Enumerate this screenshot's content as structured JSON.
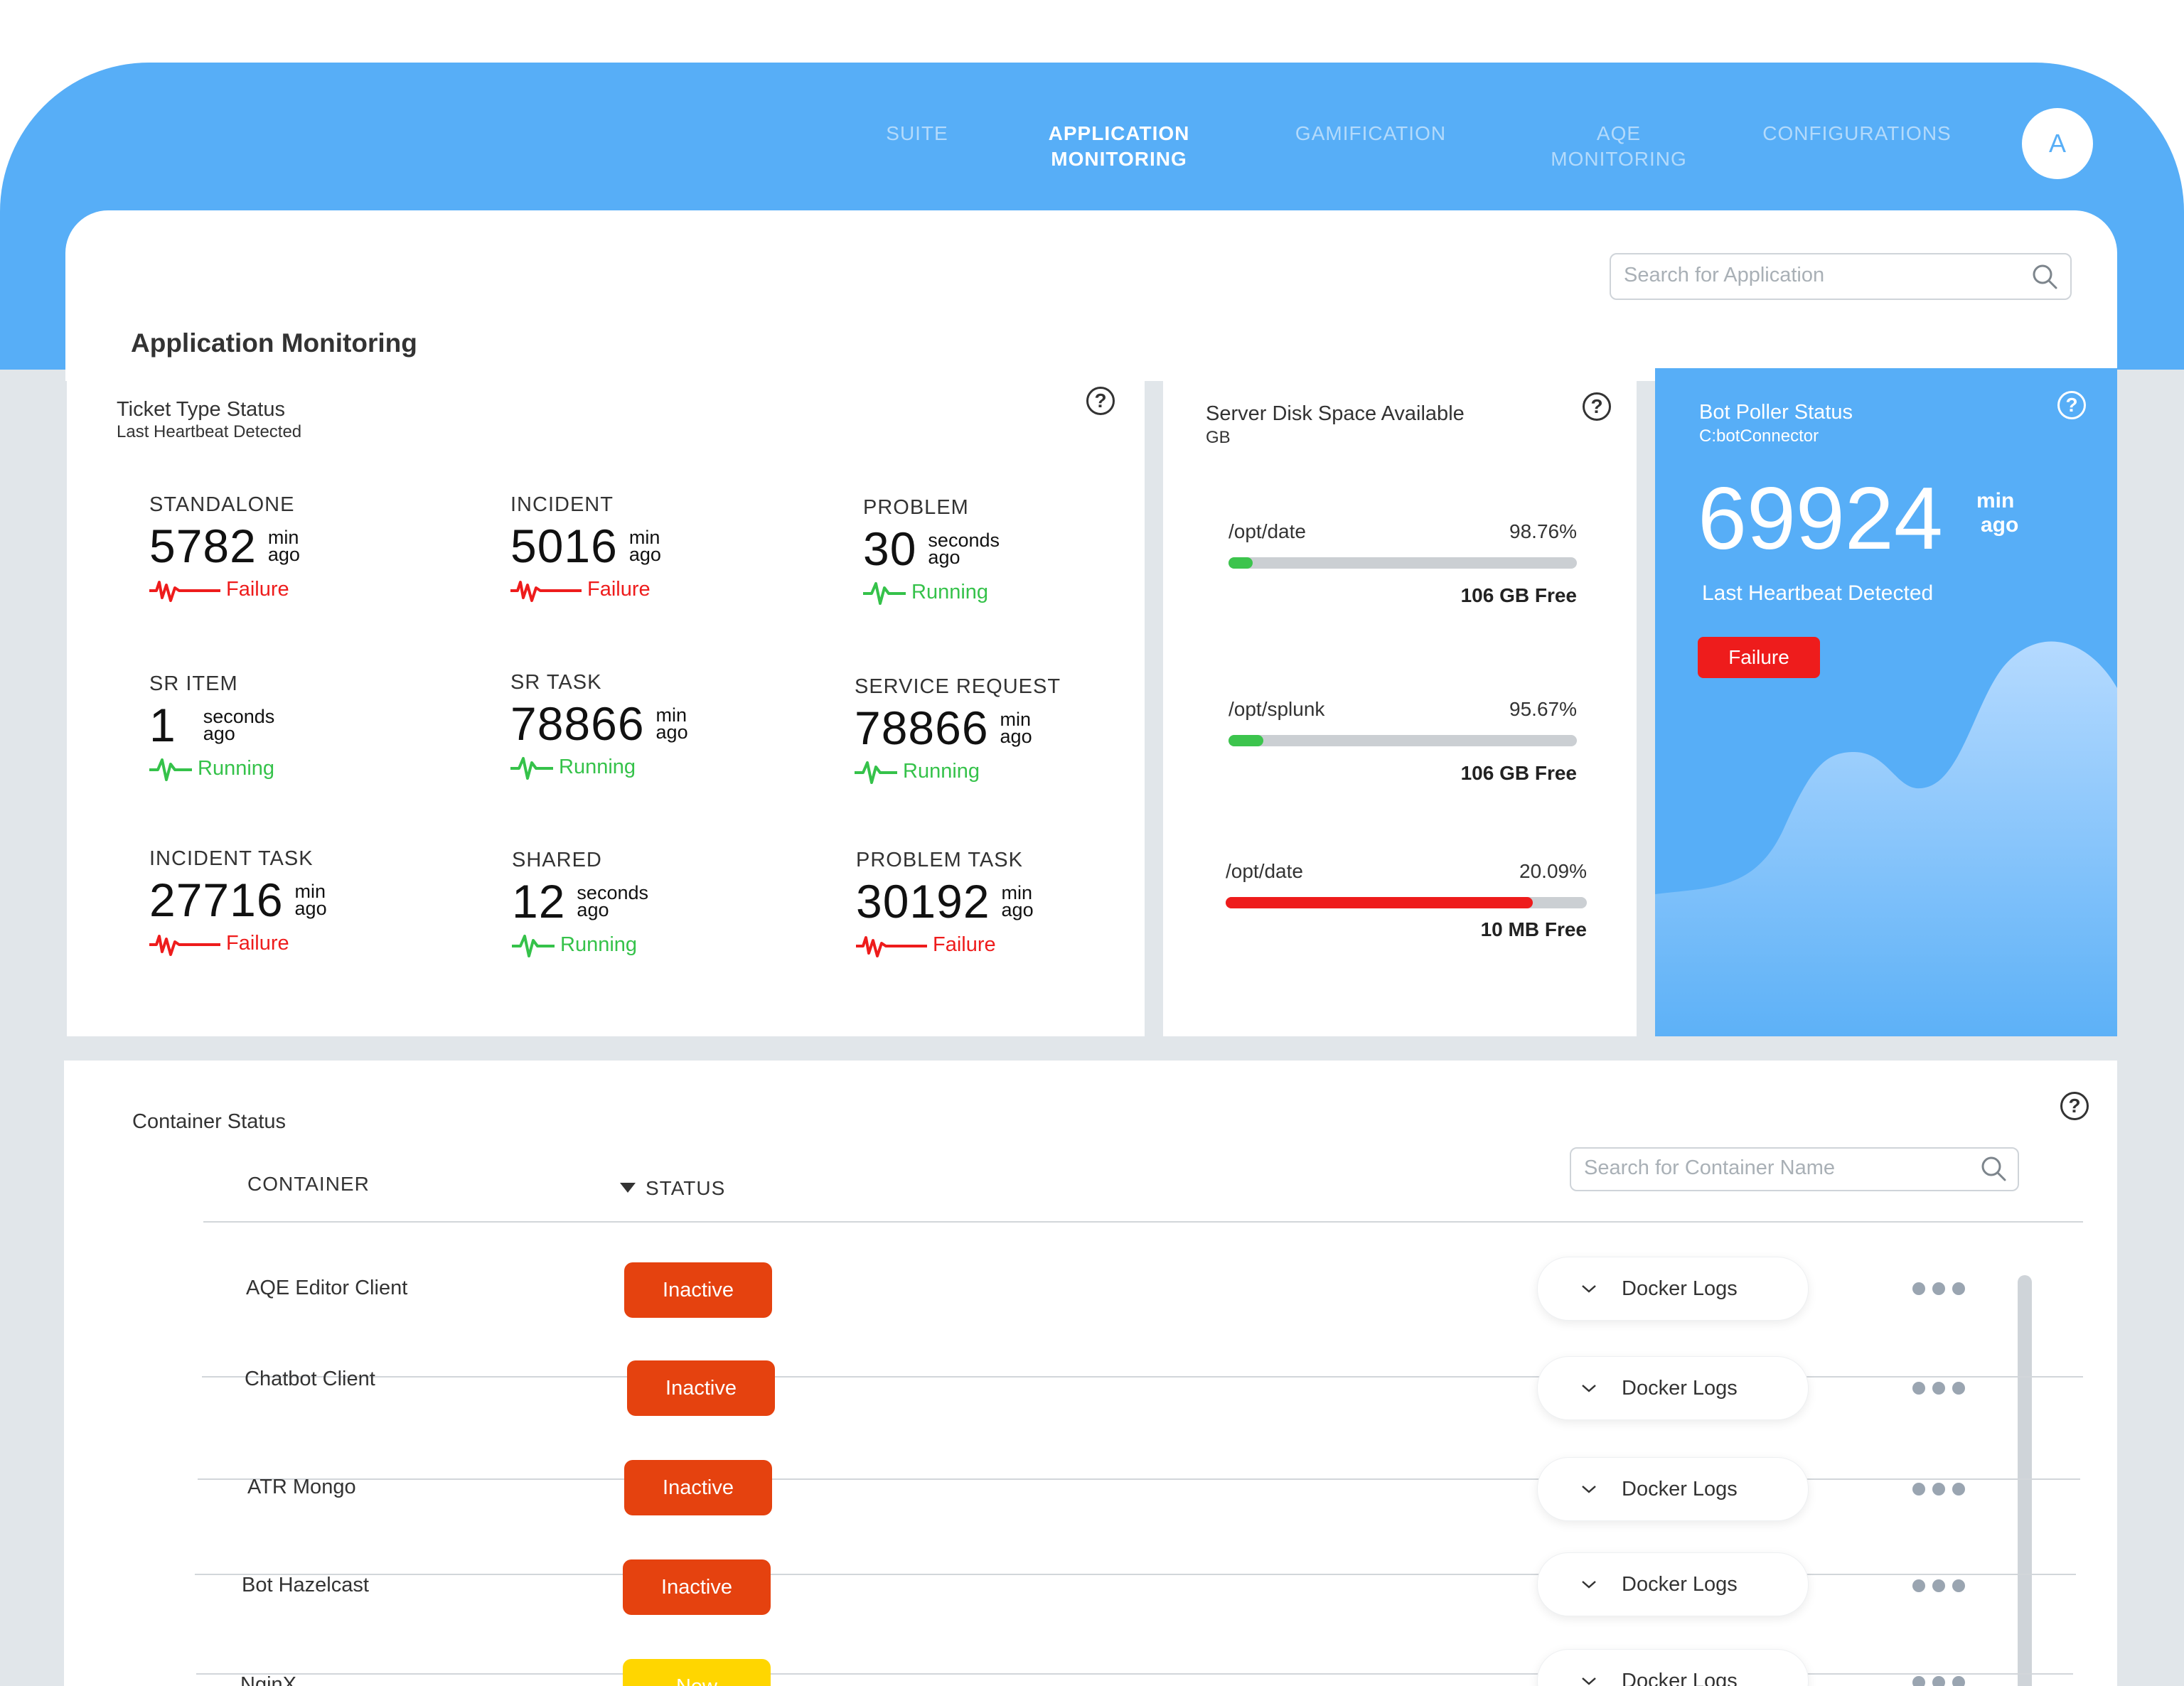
{
  "nav": {
    "items": [
      {
        "label": "SUITE"
      },
      {
        "label": "APPLICATION MONITORING"
      },
      {
        "label": "GAMIFICATION"
      },
      {
        "label": "AQE MONITORING"
      },
      {
        "label": "CONFIGURATIONS"
      }
    ],
    "active_index": 1,
    "avatar_initial": "A"
  },
  "header": {
    "title": "Application Monitoring",
    "search_placeholder": "Search for Application"
  },
  "ticket_card": {
    "title": "Ticket Type Status",
    "subtitle": "Last Heartbeat Detected",
    "items": [
      {
        "name": "STANDALONE",
        "value": "5782",
        "unit": "min ago",
        "status": "Failure"
      },
      {
        "name": "INCIDENT",
        "value": "5016",
        "unit": "min ago",
        "status": "Failure"
      },
      {
        "name": "PROBLEM",
        "value": "30",
        "unit": "seconds ago",
        "status": "Running"
      },
      {
        "name": "SR ITEM",
        "value": "1",
        "unit": "seconds ago",
        "status": "Running"
      },
      {
        "name": "SR TASK",
        "value": "78866",
        "unit": "min ago",
        "status": "Running"
      },
      {
        "name": "SERVICE REQUEST",
        "value": "78866",
        "unit": "min ago",
        "status": "Running"
      },
      {
        "name": "INCIDENT TASK",
        "value": "27716",
        "unit": "min ago",
        "status": "Failure"
      },
      {
        "name": "SHARED",
        "value": "12",
        "unit": "seconds ago",
        "status": "Running"
      },
      {
        "name": "PROBLEM TASK",
        "value": "30192",
        "unit": "min ago",
        "status": "Failure"
      }
    ]
  },
  "disk_card": {
    "title": "Server Disk Space Available",
    "subtitle": "GB",
    "items": [
      {
        "path": "/opt/date",
        "percent": "98.76%",
        "free": "106 GB Free",
        "fill_fraction": 0.07,
        "color": "#3cc44d"
      },
      {
        "path": "/opt/splunk",
        "percent": "95.67%",
        "free": "106 GB Free",
        "fill_fraction": 0.1,
        "color": "#3cc44d"
      },
      {
        "path": "/opt/date",
        "percent": "20.09%",
        "free": "10 MB Free",
        "fill_fraction": 0.85,
        "color": "#ee1c1c"
      }
    ]
  },
  "bot_card": {
    "title": "Bot Poller Status",
    "subtitle": "C:botConnector",
    "value": "69924",
    "unit_line1": "min",
    "unit_line2": "ago",
    "caption": "Last Heartbeat Detected",
    "status": "Failure"
  },
  "containers": {
    "title": "Container Status",
    "col_container": "CONTAINER",
    "col_status": "STATUS",
    "search_placeholder": "Search for Container Name",
    "logs_label": "Docker Logs",
    "rows": [
      {
        "name": "AQE Editor Client",
        "status": "Inactive",
        "color": "#e5420f"
      },
      {
        "name": "Chatbot Client",
        "status": "Inactive",
        "color": "#e5420f"
      },
      {
        "name": "ATR Mongo",
        "status": "Inactive",
        "color": "#e5420f"
      },
      {
        "name": "Bot Hazelcast",
        "status": "Inactive",
        "color": "#e5420f"
      },
      {
        "name": "NginX",
        "status": "New",
        "color": "#ffd600"
      }
    ]
  },
  "colors": {
    "primary": "#57aef7",
    "failure": "#ee1c1c",
    "running": "#35c24a",
    "inactive": "#e5420f",
    "new": "#ffd600"
  },
  "icons": [
    "search-icon",
    "help-icon",
    "pulse-icon",
    "chevron-down-icon",
    "more-icon",
    "sort-down-icon"
  ]
}
